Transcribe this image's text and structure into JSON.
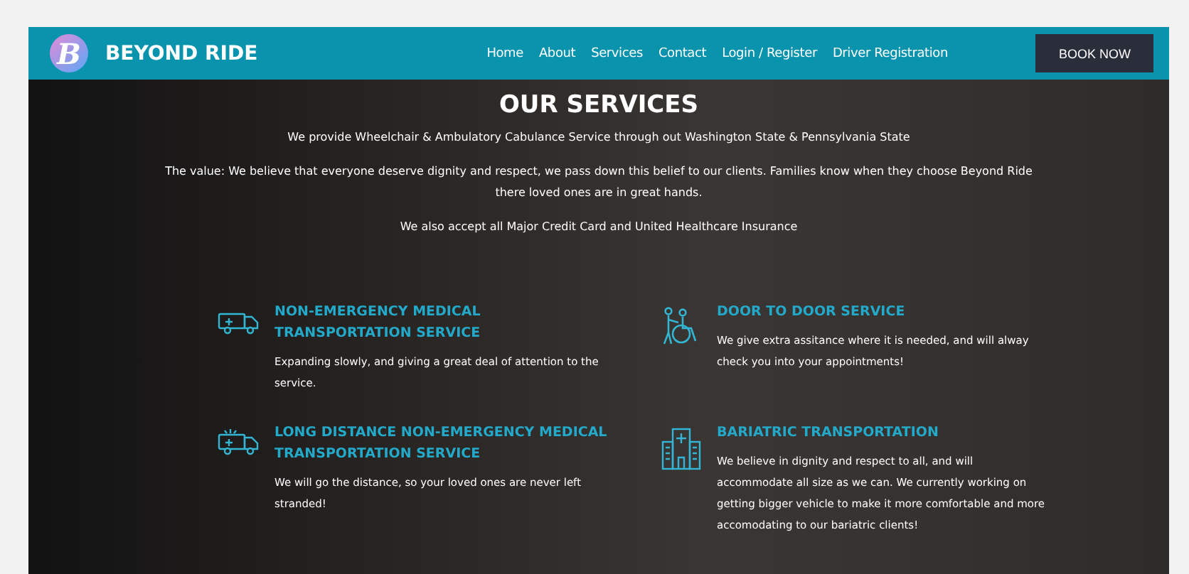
{
  "header": {
    "brand": "BEYOND RIDE",
    "logo_letter": "B",
    "nav": [
      {
        "label": "Home"
      },
      {
        "label": "About"
      },
      {
        "label": "Services"
      },
      {
        "label": "Contact"
      },
      {
        "label": "Login / Register"
      },
      {
        "label": "Driver Registration"
      }
    ],
    "cta": "BOOK NOW"
  },
  "intro": {
    "title": "OUR SERVICES",
    "paragraphs": [
      "We provide Wheelchair & Ambulatory Cabulance Service through out Washington State &  Pennsylvania State",
      "The value: We believe that everyone deserve dignity and respect, we pass down this belief to our clients.  Families know when they choose  Beyond  Ride there loved ones are in great hands.",
      "We also accept all  Major Credit Card and United  Healthcare  Insurance"
    ]
  },
  "services": [
    {
      "kind": "ambulance",
      "title": "NON-EMERGENCY MEDICAL TRANSPORTATION SERVICE",
      "text": "Expanding slowly, and giving a great deal of attention to the service."
    },
    {
      "kind": "wheelchair",
      "title": "DOOR TO DOOR SERVICE",
      "text": "We give extra assitance where it is needed, and will alway check you into your appointments!"
    },
    {
      "kind": "ambulance-siren",
      "title": "LONG DISTANCE NON-EMERGENCY MEDICAL TRANSPORTATION SERVICE",
      "text": "We will go the distance, so your loved ones are never left stranded!"
    },
    {
      "kind": "hospital",
      "title": "BARIATRIC TRANSPORTATION",
      "text": "We believe in dignity and respect to all, and will accommodate all size as we can. We currently working on getting bigger vehicle to make it more comfortable and more accomodating to our bariatric clients!"
    }
  ]
}
